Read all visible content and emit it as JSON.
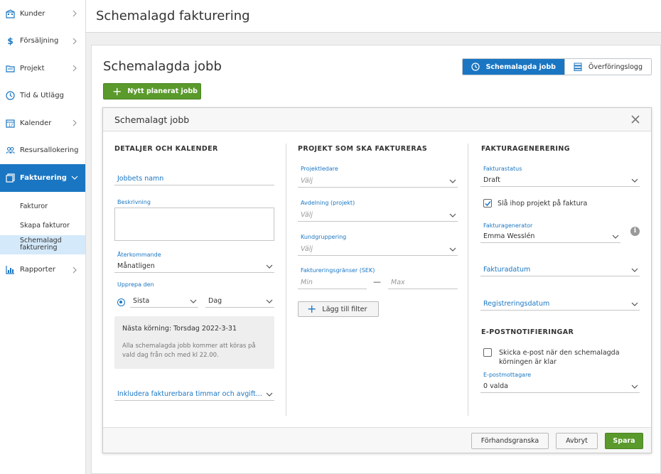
{
  "sidebar": {
    "items": [
      {
        "label": "Kunder",
        "icon": "building-icon",
        "chevron": true
      },
      {
        "label": "Försäljning",
        "icon": "dollar-icon",
        "chevron": true
      },
      {
        "label": "Projekt",
        "icon": "folder-icon",
        "chevron": true
      },
      {
        "label": "Tid & Utlägg",
        "icon": "clock-icon",
        "chevron": false
      },
      {
        "label": "Kalender",
        "icon": "calendar-icon",
        "chevron": true
      },
      {
        "label": "Resursallokering",
        "icon": "people-icon",
        "chevron": false
      },
      {
        "label": "Fakturering",
        "icon": "invoice-icon",
        "chevron": true,
        "active": true
      },
      {
        "label": "Rapporter",
        "icon": "chart-icon",
        "chevron": true
      }
    ],
    "subitems": [
      "Fakturor",
      "Skapa fakturor",
      "Schemalagd fakturering"
    ]
  },
  "header": {
    "title": "Schemalagd fakturering"
  },
  "main": {
    "title": "Schemalagda jobb",
    "tab_scheduled": "Schemalagda jobb",
    "tab_log": "Överföringslogg",
    "new_button": "Nytt planerat jobb"
  },
  "dialog": {
    "title": "Schemalagt jobb",
    "col1": {
      "heading": "DETALJER OCH KALENDER",
      "job_name_placeholder": "Jobbets namn",
      "description_label": "Beskrivning",
      "recurring_label": "Återkommande",
      "recurring_value": "Månatligen",
      "repeat_label": "Upprepa den",
      "repeat_which": "Sista",
      "repeat_unit": "Dag",
      "next_run": "Nästa körning: Torsdag 2022-3-31",
      "next_run_info": "Alla schemalagda jobb kommer att köras på vald dag från och med kl 22.00.",
      "include_label": "Inkludera fakturerbara timmar och avgift..."
    },
    "col2": {
      "heading": "PROJEKT SOM SKA FAKTURERAS",
      "pm_label": "Projektledare",
      "pm_placeholder": "Välj",
      "dept_label": "Avdelning (projekt)",
      "dept_placeholder": "Välj",
      "group_label": "Kundgruppering",
      "group_placeholder": "Välj",
      "limits_label": "Faktureringsgränser (SEK)",
      "min_placeholder": "Min",
      "max_placeholder": "Max",
      "dash": "—",
      "add_filter": "Lägg till filter"
    },
    "col3": {
      "heading": "FAKTURAGENERERING",
      "status_label": "Fakturastatus",
      "status_value": "Draft",
      "merge_label": "Slå ihop projekt på faktura",
      "merge_checked": true,
      "generator_label": "Fakturagenerator",
      "generator_value": "Emma Wesslén",
      "info_glyph": "i",
      "invoice_date_label": "Fakturadatum",
      "reg_date_label": "Registreringsdatum",
      "email_heading": "E-POSTNOTIFIERINGAR",
      "email_send_label": "Skicka e-post när den schemalagda körningen är klar",
      "email_send_checked": false,
      "recipients_label": "E-postmottagare",
      "recipients_value": "0 valda"
    },
    "footer": {
      "preview": "Förhandsgranska",
      "cancel": "Avbryt",
      "save": "Spara"
    }
  },
  "colors": {
    "accent": "#1a76c2",
    "success": "#5a9a2c",
    "active_sub": "#d4e9fa"
  }
}
